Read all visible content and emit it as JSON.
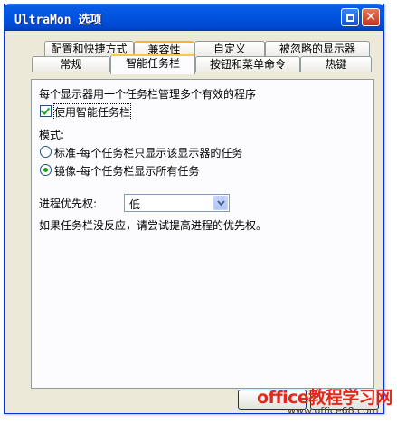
{
  "window": {
    "title": "UltraMon 选项",
    "help_icon": "window-help-icon",
    "close_icon": "window-close-icon"
  },
  "tabs": {
    "row1": [
      "配置和快捷方式",
      "兼容性",
      "自定义",
      "被忽略的显示器"
    ],
    "row2": [
      "常规",
      "智能任务栏",
      "按钮和菜单命令",
      "热键"
    ],
    "active": "智能任务栏"
  },
  "panel": {
    "description": "每个显示器用一个任务栏管理多个有效的程序",
    "use_smart_taskbar": {
      "label": "使用智能任务栏",
      "checked": true
    },
    "mode_label": "模式:",
    "modes": [
      {
        "label": "标准-每个任务栏只显示该显示器的任务",
        "selected": false
      },
      {
        "label": "镜像-每个任务栏显示所有任务",
        "selected": true
      }
    ],
    "priority_label": "进程优先权:",
    "priority_value": "低",
    "hint": "如果任务栏没反应，请尝试提高进程的优先权。"
  },
  "watermark": {
    "line1": "office教程学习网",
    "line2": "www.office68.com"
  },
  "colors": {
    "title_bar": "#0053e0",
    "dialog_bg": "#ece9d8",
    "active_tab_accent": "#ffc83c",
    "watermark_red": "#e3291c"
  }
}
